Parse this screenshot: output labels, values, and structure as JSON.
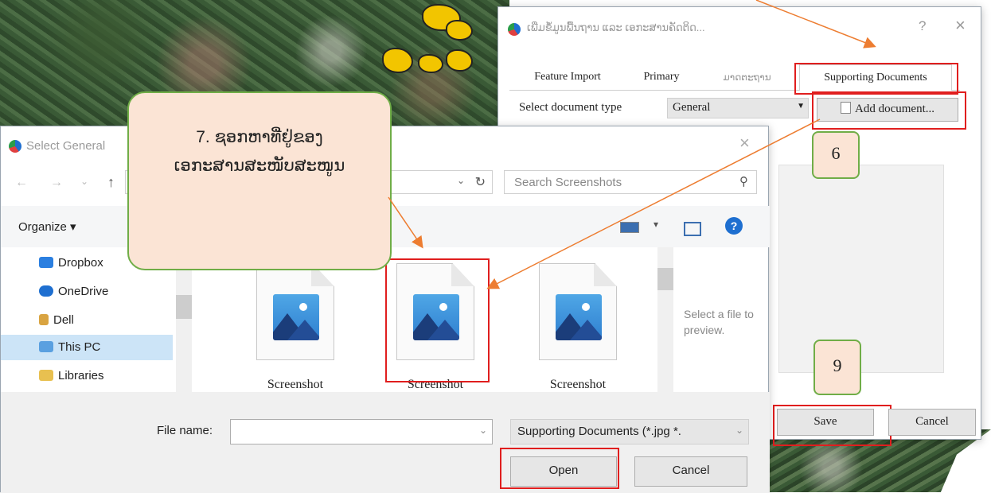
{
  "right_dialog": {
    "title": "ເພີ່ມຂໍ້ມູນພື້ນຖານ ແລະ ເອກະສານຄັດຕິດ...",
    "help_label": "?",
    "close_label": "×",
    "tabs": [
      "Feature Import",
      "Primary",
      "ມາດຕະຖານ",
      "Supporting Documents"
    ],
    "doc_type_label": "Select document type",
    "doc_type_value": "General",
    "add_document_label": "Add document...",
    "save_label": "Save",
    "cancel_label": "Cancel"
  },
  "left_dialog": {
    "title": "Select General",
    "close_label": "×",
    "search_placeholder": "Search Screenshots",
    "organize_label": "Organize ▾",
    "nav_items": [
      "Dropbox",
      "OneDrive",
      "Dell",
      "This PC",
      "Libraries"
    ],
    "files": [
      "Screenshot",
      "Screenshot",
      "Screenshot"
    ],
    "preview_text": "Select a file to preview.",
    "file_name_label": "File name:",
    "file_name_value": "",
    "file_type_value": "Supporting Documents (*.jpg *.",
    "open_label": "Open",
    "cancel_label": "Cancel"
  },
  "annotations": {
    "callout_line1": "7. ຊອກຫາທີ່ຢູ່ຂອງ",
    "callout_line2": "ເອກະສານສະໜັບສະໜູນ",
    "step6": "6",
    "step9": "9"
  },
  "colors": {
    "highlight": "#e01e1e",
    "callout_fill": "#fbe4d5",
    "callout_border": "#70ad47",
    "arrow": "#ed7d31"
  }
}
